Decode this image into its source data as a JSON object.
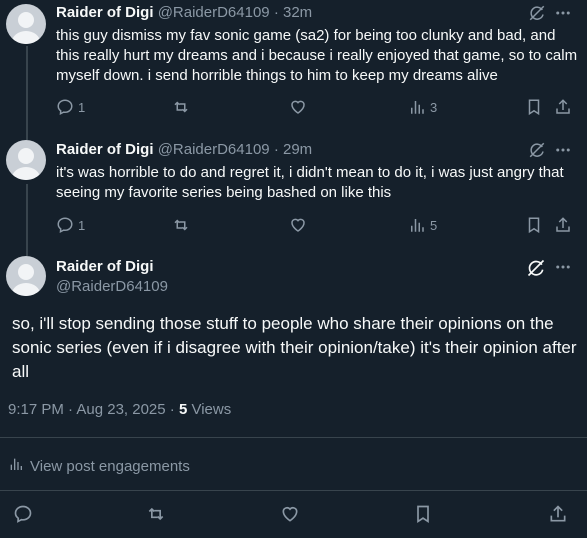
{
  "colors": {
    "background": "#15202b",
    "text": "#f7f9f9",
    "muted": "#8b98a5",
    "divider": "#38444d"
  },
  "posts": [
    {
      "display_name": "Raider of Digi",
      "handle": "@RaiderD64109",
      "time": "· 32m",
      "text": "this guy dismiss my fav sonic game (sa2) for being too clunky and bad, and this really hurt my dreams and i because i really enjoyed that game, so to calm myself down. i send horrible things to him to keep my dreams alive",
      "replies": "1",
      "views": "3"
    },
    {
      "display_name": "Raider of Digi",
      "handle": "@RaiderD64109",
      "time": "· 29m",
      "text": "it's was horrible to do and regret it, i didn't mean to do it, i was just angry that seeing my favorite series being bashed on like this",
      "replies": "1",
      "views": "5"
    }
  ],
  "main_post": {
    "display_name": "Raider of Digi",
    "handle": "@RaiderD64109",
    "text": "so, i'll stop sending those stuff to people who share their opinions on the sonic series (even if i disagree with  their opinion/take) it's their opinion after all",
    "timestamp": "9:17 PM · Aug 23, 2025 · ",
    "views_count": "5",
    "views_label": " Views",
    "engagements_link": "View post engagements"
  },
  "icons": [
    "grok-icon",
    "more-icon",
    "reply-icon",
    "repost-icon",
    "like-icon",
    "views-icon",
    "bookmark-icon",
    "share-icon"
  ]
}
